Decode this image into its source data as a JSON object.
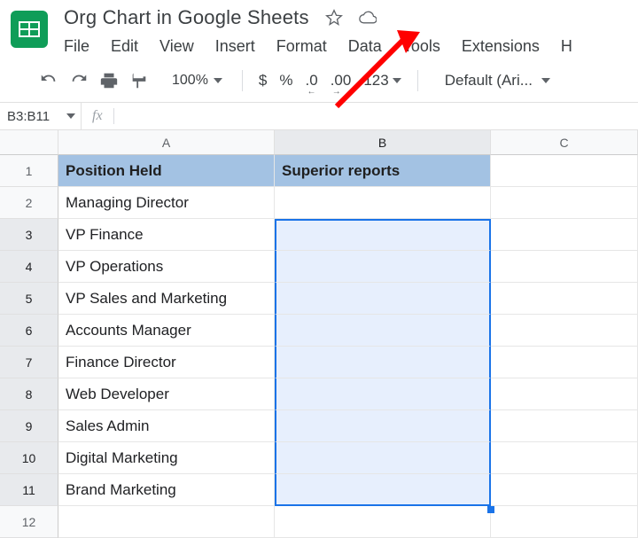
{
  "doc": {
    "title": "Org Chart in Google Sheets"
  },
  "menus": {
    "file": "File",
    "edit": "Edit",
    "view": "View",
    "insert": "Insert",
    "format": "Format",
    "data": "Data",
    "tools": "Tools",
    "extensions": "Extensions",
    "help": "H"
  },
  "toolbar": {
    "zoom": "100%",
    "currency": "$",
    "percent": "%",
    "dec_less": ".0",
    "dec_more": ".00",
    "num_fmt": "123",
    "font": "Default (Ari..."
  },
  "namebox": {
    "range": "B3:B11",
    "fx": "fx"
  },
  "columns": {
    "A": "A",
    "B": "B",
    "C": "C"
  },
  "rows": {
    "labels": [
      "1",
      "2",
      "3",
      "4",
      "5",
      "6",
      "7",
      "8",
      "9",
      "10",
      "11",
      "12"
    ],
    "header": {
      "A": "Position Held",
      "B": "Superior reports"
    },
    "dataA": [
      "Managing Director",
      "VP Finance",
      "VP Operations",
      "VP Sales and Marketing",
      "Accounts Manager",
      "Finance Director",
      "Web Developer",
      "Sales Admin",
      "Digital Marketing",
      "Brand Marketing"
    ]
  }
}
